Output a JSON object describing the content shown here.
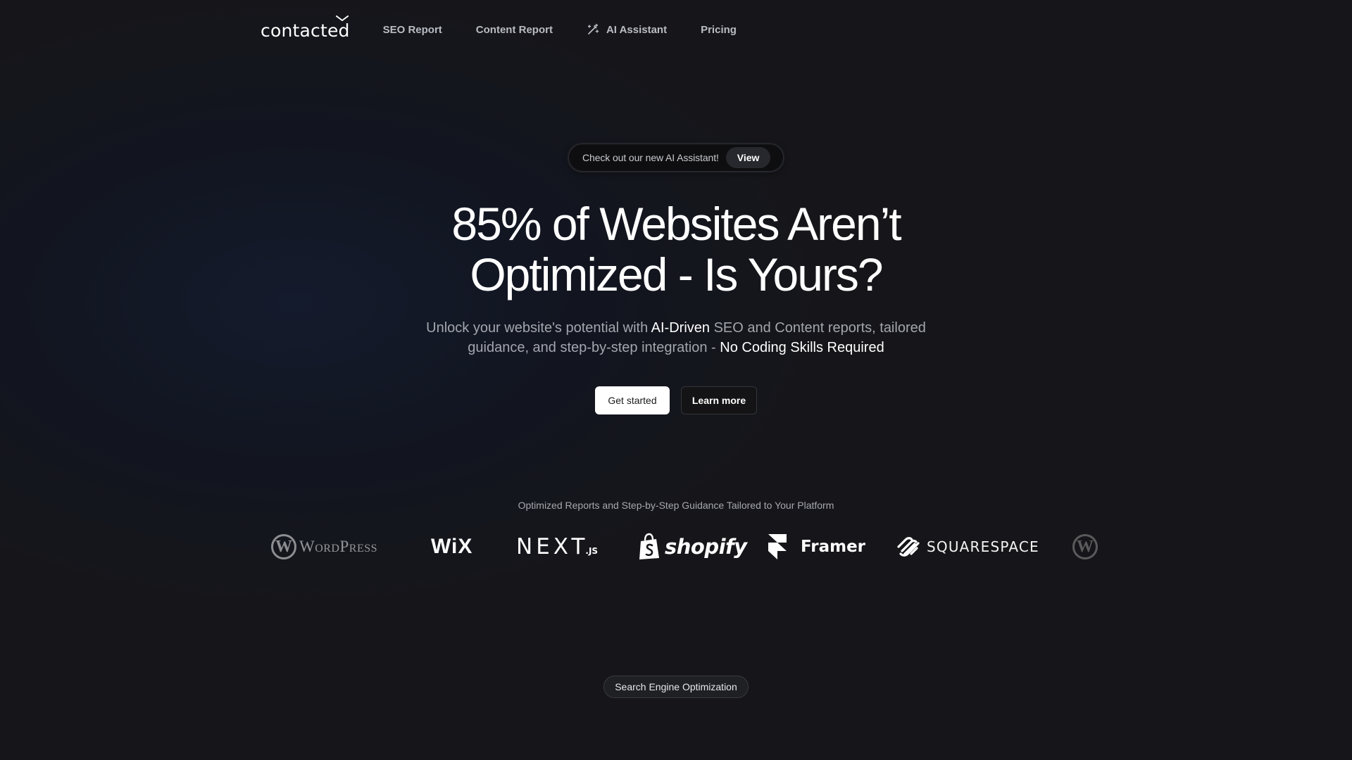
{
  "nav": {
    "logo_text": "contacted",
    "links": [
      {
        "label": "SEO Report"
      },
      {
        "label": "Content Report"
      },
      {
        "label": "AI Assistant",
        "icon": "wand-sparkle-icon"
      },
      {
        "label": "Pricing"
      }
    ]
  },
  "announcement": {
    "text": "Check out our new AI Assistant!",
    "action_label": "View"
  },
  "hero": {
    "title_line1": "85% of Websites Aren’t",
    "title_line2": "Optimized - Is Yours?",
    "sub_part1": "Unlock your website's potential with ",
    "sub_highlight1": "AI-Driven",
    "sub_part2": " SEO and Content reports, tailored guidance, and step-by-step integration - ",
    "sub_highlight2": "No Coding Skills Required"
  },
  "cta": {
    "primary_label": "Get started",
    "secondary_label": "Learn more"
  },
  "platforms": {
    "caption": "Optimized Reports and Step-by-Step Guidance Tailored to Your Platform",
    "logos": [
      {
        "name": "wordpress-logo",
        "mark": "W",
        "text": "WordPress"
      },
      {
        "name": "wix-logo",
        "text": "WiX"
      },
      {
        "name": "nextjs-logo",
        "text": "NEXT",
        "suffix": ".JS"
      },
      {
        "name": "shopify-logo",
        "text": "shopify"
      },
      {
        "name": "framer-logo",
        "text": "Framer"
      },
      {
        "name": "squarespace-logo",
        "text": "SQUARESPACE"
      },
      {
        "name": "wordpress-logo-repeat",
        "mark": "W"
      }
    ]
  },
  "section_badge": {
    "label": "Search Engine Optimization"
  },
  "colors": {
    "background": "#17171a",
    "text_primary": "#ffffff",
    "text_muted": "#a3a6ad",
    "nav_link": "#b9bcc3"
  }
}
